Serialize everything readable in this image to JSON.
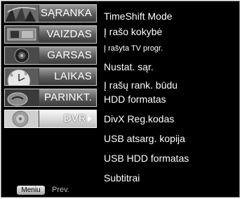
{
  "menu": {
    "items": [
      {
        "label": "SĄRANKA",
        "icon": "setup-thumbnail-icon",
        "active": false
      },
      {
        "label": "VAIZDAS",
        "icon": "picture-thumbnail-icon",
        "active": false
      },
      {
        "label": "GARSAS",
        "icon": "audio-thumbnail-icon",
        "active": false
      },
      {
        "label": "LAIKAS",
        "icon": "clock-thumbnail-icon",
        "active": false
      },
      {
        "label": "PARINKT.",
        "icon": "special-thumbnail-icon",
        "active": false
      },
      {
        "label": "DVR",
        "icon": "disc-thumbnail-icon",
        "active": true
      }
    ],
    "footer": {
      "menu_button": "Meniu",
      "prev_label": "Prev."
    }
  },
  "submenu": {
    "items": [
      {
        "label": "TimeShift Mode",
        "size": "normal"
      },
      {
        "label": "Į rašo kokybė",
        "size": "normal"
      },
      {
        "label": "Į rašyta TV progr.",
        "size": "small"
      },
      {
        "label": "Nustat. sąr.",
        "size": "normal"
      },
      {
        "label": "Į rašų rank. būdu",
        "size": "normal"
      },
      {
        "label": "HDD formatas",
        "size": "normal"
      },
      {
        "label": "DivX Reg.kodas",
        "size": "normal"
      },
      {
        "label": "USB atsarg. kopija",
        "size": "normal"
      },
      {
        "label": "USB HDD formatas",
        "size": "normal"
      },
      {
        "label": "Subtitrai",
        "size": "normal"
      }
    ]
  },
  "colors": {
    "background": "#000000",
    "text": "#ffffff",
    "active_item": "#d9d9d9"
  }
}
